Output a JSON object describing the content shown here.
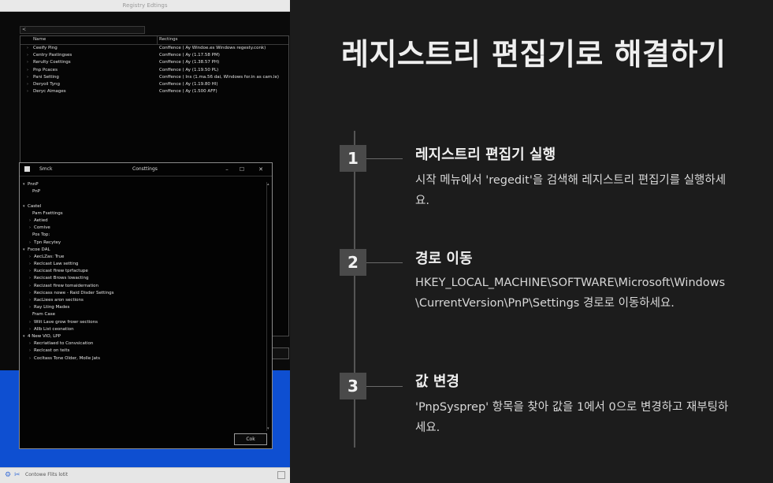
{
  "screenshot": {
    "window_title": "Registry Edtings",
    "address": "<",
    "table": {
      "headers": [
        "Name",
        "Rectings"
      ],
      "rows": [
        {
          "name": "Ceeify Ping",
          "value": "Conffence ( Ay Windoe.es Windows regesty.conk)"
        },
        {
          "name": "Centry Pastingses",
          "value": "Conffence ( Ay (1.17.58 PM)"
        },
        {
          "name": "Rerulty Coettings",
          "value": "Conffence ( Ay (1.38.57 PH)"
        },
        {
          "name": "Pnp Pcaces",
          "value": "Conffence ( Ay (1.19.50 PL)"
        },
        {
          "name": "Pani Setting",
          "value": "Conffence ( Ins (1.ma.56 dai, Windows for.in as cam.le)"
        },
        {
          "name": "Deryoil Tyng",
          "value": "Conffence ( Ay (1.19.80 HI)"
        },
        {
          "name": "Deryc Aimages",
          "value": "Conffence ( Ay (1.500 AFF)"
        }
      ]
    },
    "dialog": {
      "app_name": "Smck",
      "title": "Consttings",
      "minimize": "–",
      "maximize": "☐",
      "close": "✕",
      "ok_label": "Cok",
      "tree": [
        {
          "text": "PnnP",
          "arrow": "▾",
          "indent": 0
        },
        {
          "text": "PnP",
          "arrow": "",
          "indent": 1
        },
        {
          "text": "",
          "arrow": "",
          "indent": 0
        },
        {
          "text": "Castel",
          "arrow": "▾",
          "indent": 0
        },
        {
          "text": "Pam Fsettings",
          "arrow": "",
          "indent": 1
        },
        {
          "text": "Aetied",
          "arrow": "›",
          "indent": 2
        },
        {
          "text": "Comive",
          "arrow": "›",
          "indent": 2
        },
        {
          "text": "Pos Top:",
          "arrow": "",
          "indent": 1
        },
        {
          "text": "Tpn Recytey",
          "arrow": "›",
          "indent": 2
        },
        {
          "text": "Fscoe DAL",
          "arrow": "▾",
          "indent": 0
        },
        {
          "text": "AecLZas: True",
          "arrow": "›",
          "indent": 2
        },
        {
          "text": "Reclcast Law setting",
          "arrow": "›",
          "indent": 2
        },
        {
          "text": "Rucicast firew tprfactupe",
          "arrow": "›",
          "indent": 2
        },
        {
          "text": "Recicast Brows lowacting",
          "arrow": "›",
          "indent": 2
        },
        {
          "text": "Recizast firew tomaidernation",
          "arrow": "›",
          "indent": 2
        },
        {
          "text": "Recicass nowe - Raid Disder Settings",
          "arrow": "›",
          "indent": 2
        },
        {
          "text": "RacLiees aron sections",
          "arrow": "›",
          "indent": 2
        },
        {
          "text": "Ray Lting Mades",
          "arrow": "›",
          "indent": 2
        },
        {
          "text": "Fram Case",
          "arrow": "",
          "indent": 1
        },
        {
          "text": "Wiit Lave grow frowr sections",
          "arrow": "›",
          "indent": 2
        },
        {
          "text": "Allb List ceonation",
          "arrow": "›",
          "indent": 2
        },
        {
          "text": "4 New VIO, LPP",
          "arrow": "▾",
          "indent": 0
        },
        {
          "text": "Recriatlaed to Convsication",
          "arrow": "›",
          "indent": 2
        },
        {
          "text": "Reclcast on teits",
          "arrow": "›",
          "indent": 2
        },
        {
          "text": "Cocltass Tone Older, Molle Jats",
          "arrow": "›",
          "indent": 2
        }
      ]
    },
    "taskbar": {
      "label": "Contowe Flits lotit"
    }
  },
  "heading": "레지스트리 편집기로 해결하기",
  "steps": [
    {
      "number": "1",
      "title": "레지스트리 편집기 실행",
      "description": "시작 메뉴에서 'regedit'을 검색해 레지스트리 편집기를 실행하세요."
    },
    {
      "number": "2",
      "title": "경로 이동",
      "description": "HKEY_LOCAL_MACHINE\\SOFTWARE\\Microsoft\\Windows\\CurrentVersion\\PnP\\Settings 경로로 이동하세요."
    },
    {
      "number": "3",
      "title": "값 변경",
      "description": "'PnpSysprep' 항목을 찾아 값을 1에서 0으로 변경하고 재부팅하세요."
    }
  ]
}
